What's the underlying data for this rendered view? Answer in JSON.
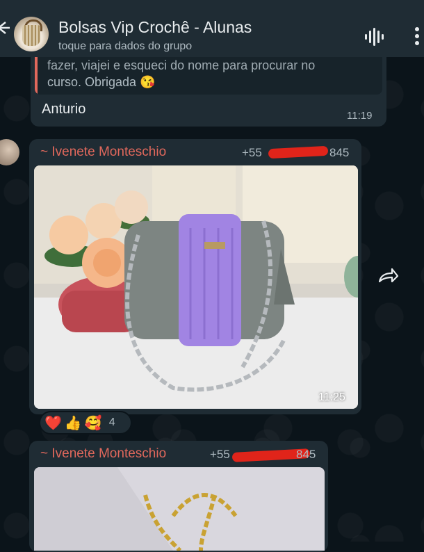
{
  "header": {
    "title": "Bolsas Vip Crochê - Alunas",
    "subtitle": "toque para dados do grupo"
  },
  "quoted_message": {
    "line1": "fazer, viajei e esqueci do nome para procurar no",
    "line2": "curso. Obrigada 😘"
  },
  "reply_message": {
    "text": "Anturio",
    "time": "11:19"
  },
  "photo_message_1": {
    "sender": "~ Ivenete Monteschio",
    "phone_prefix": "+55",
    "phone_suffix": "845",
    "time": "11:25",
    "reactions": [
      "❤️",
      "👍",
      "🥰"
    ],
    "reaction_count": "4"
  },
  "photo_message_2": {
    "sender": "~ Ivenete Monteschio",
    "phone_prefix": "+55",
    "phone_suffix": "845"
  },
  "colors": {
    "background": "#0b141a",
    "bubble": "#1f2c34",
    "sender_name": "#e0685c",
    "secondary_text": "#aebac1"
  }
}
